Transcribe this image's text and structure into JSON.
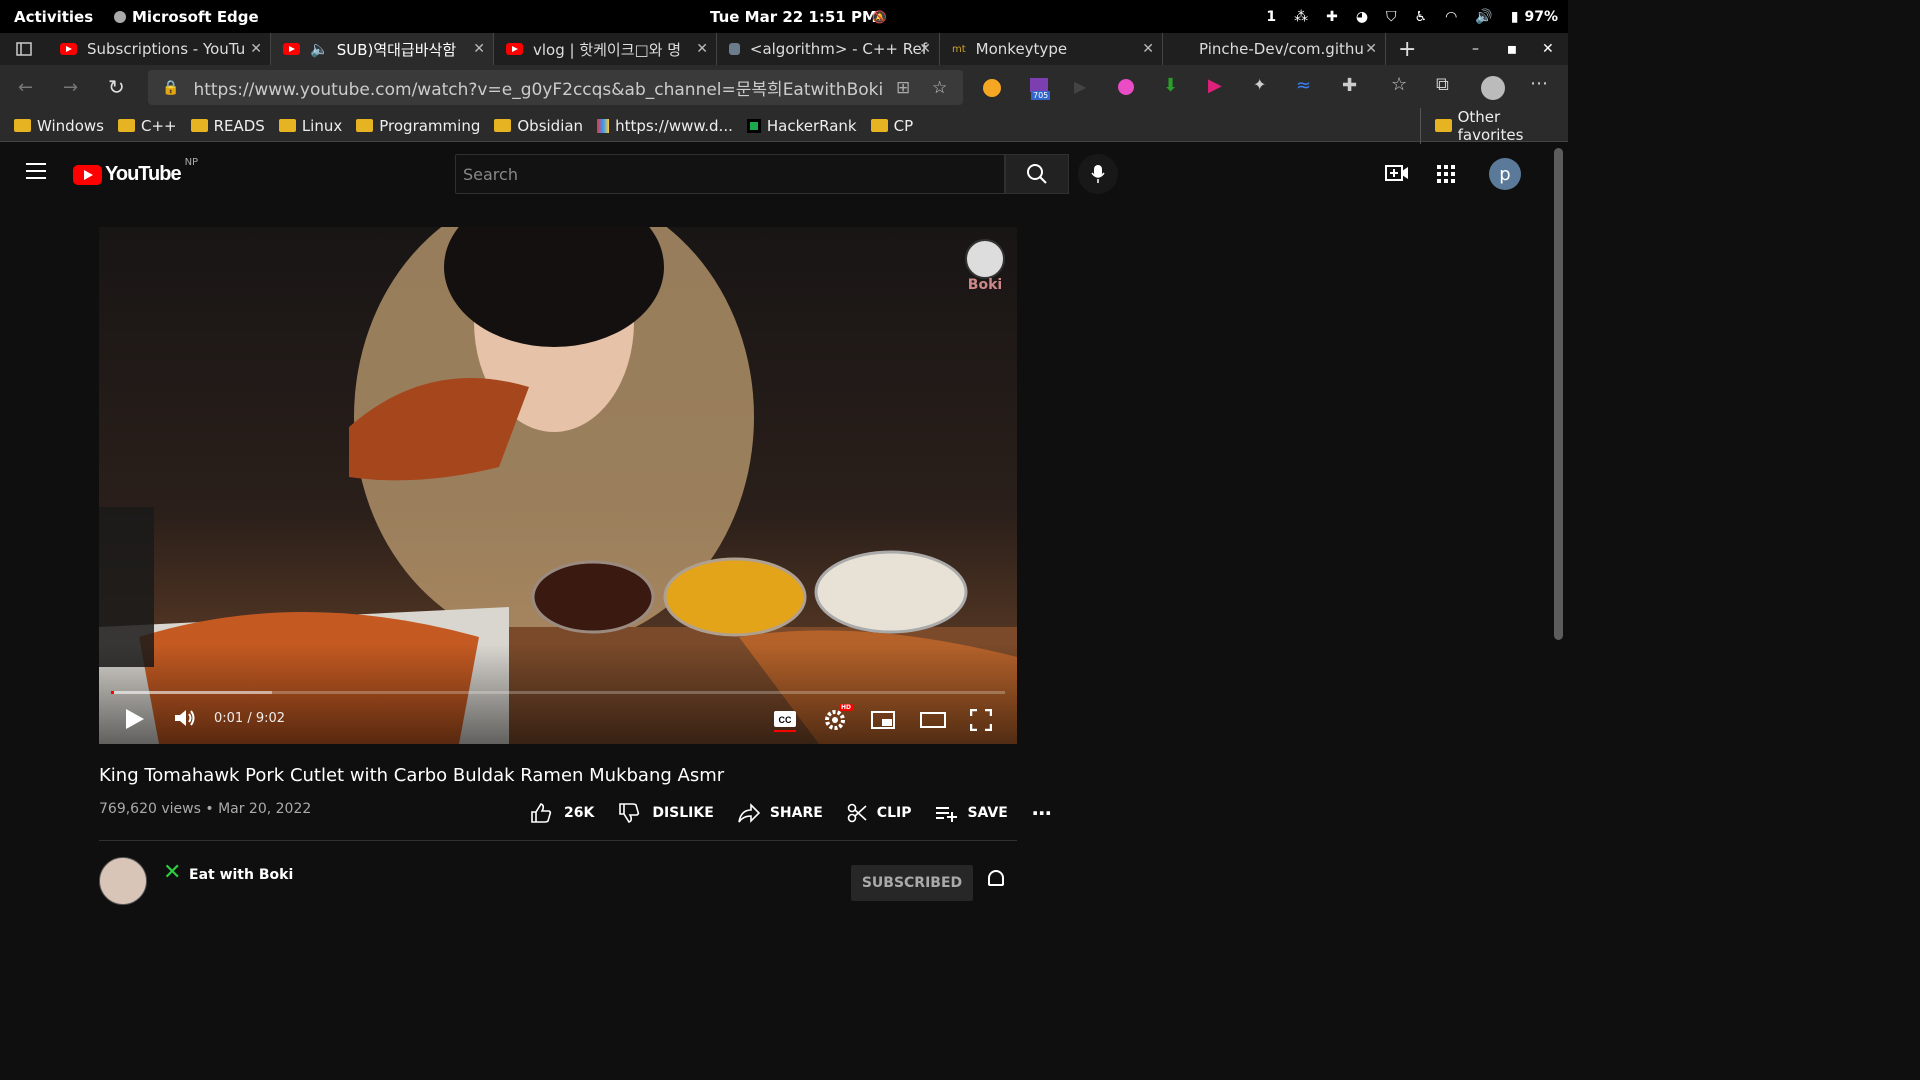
{
  "system": {
    "activities": "Activities",
    "app_name": "Microsoft Edge",
    "clock": "Tue Mar 22  1:51 PM",
    "workspace": "1",
    "battery": "97%"
  },
  "tabs": [
    {
      "title": "Subscriptions - YouTu",
      "icon": "youtube-icon"
    },
    {
      "title": "SUB)역대급바삭함",
      "icon": "youtube-icon",
      "audio": true
    },
    {
      "title": "vlog | 핫케이크□와 명",
      "icon": "youtube-icon"
    },
    {
      "title": "<algorithm> - C++ Ref",
      "icon": "cpp-ref-icon"
    },
    {
      "title": "Monkeytype",
      "icon": "monkeytype-icon"
    },
    {
      "title": "Pinche-Dev/com.githu",
      "icon": "github-icon"
    }
  ],
  "address_bar": {
    "url": "https://www.youtube.com/watch?v=e_g0yF2ccqs&ab_channel=문복희EatwithBoki",
    "extension_badge": "705"
  },
  "bookmarks": [
    {
      "label": "Windows",
      "type": "folder"
    },
    {
      "label": "C++",
      "type": "folder"
    },
    {
      "label": "READS",
      "type": "folder"
    },
    {
      "label": "Linux",
      "type": "folder"
    },
    {
      "label": "Programming",
      "type": "folder"
    },
    {
      "label": "Obsidian",
      "type": "folder"
    },
    {
      "label": "https://www.d...",
      "type": "link"
    },
    {
      "label": "HackerRank",
      "type": "link"
    },
    {
      "label": "CP",
      "type": "folder"
    }
  ],
  "other_favorites": "Other favorites",
  "youtube": {
    "logo_text": "YouTube",
    "region": "NP",
    "search_placeholder": "Search",
    "avatar_letter": "p"
  },
  "player": {
    "time": "0:01 / 9:02",
    "progress_fraction": 0.002,
    "buffered_fraction": 0.18,
    "watermark": "Boki",
    "hd_badge": "HD"
  },
  "video": {
    "title": "King Tomahawk Pork Cutlet with Carbo Buldak Ramen Mukbang Asmr",
    "views": "769,620 views",
    "date": "Mar 20, 2022",
    "likes": "26K",
    "dislike": "DISLIKE",
    "share": "SHARE",
    "clip": "CLIP",
    "save": "SAVE",
    "channel": "Eat with Boki",
    "subscribed": "SUBSCRIBED"
  },
  "colors": {
    "yt_red": "#ff0000",
    "background": "#0f0f0f",
    "chrome": "#2b2b2b"
  }
}
